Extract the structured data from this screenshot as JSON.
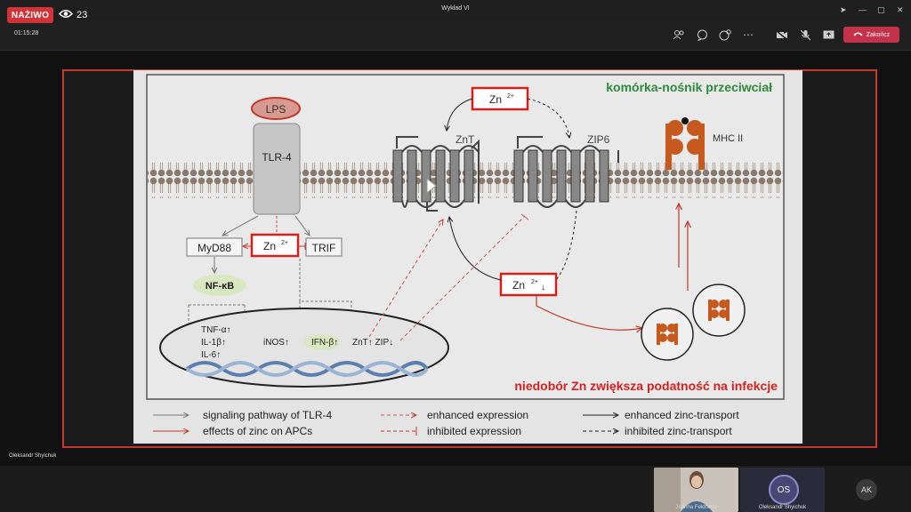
{
  "window": {
    "title": "Wykład VI"
  },
  "live": {
    "badge": "NAŻIWO",
    "viewers": "23"
  },
  "toolbar": {
    "timer": "01:15:28",
    "end_label": "Zakończ"
  },
  "presenter": {
    "name": "Oleksandr Shyichuk"
  },
  "participants": [
    {
      "name": "Joanna Feldheim",
      "initials": ""
    },
    {
      "name": "Oleksandr Shyichuk",
      "initials": "OS"
    },
    {
      "name": "",
      "initials": "AK"
    }
  ],
  "slide": {
    "title": "komórka-nośnik przeciwciał",
    "subtitle": "niedobór Zn zwiększa  podatność na infekcje",
    "labels": {
      "lps": "LPS",
      "tlr4": "TLR-4",
      "myd88": "MyD88",
      "zn": "Zn",
      "trif": "TRIF",
      "nfkb": "NF-κB",
      "znt": "ZnT",
      "zip6": "ZIP6",
      "mhc": "MHC II",
      "tnf": "TNF-α↑",
      "il1": "IL-1β↑",
      "il6": "IL-6↑",
      "inos": "iNOS↑",
      "ifn": "IFN-β↑",
      "znt_zip": "ZnT↑ ZIP↓"
    },
    "legend": [
      {
        "text": "signaling pathway of TLR-4",
        "color": "#777777",
        "style": "solid"
      },
      {
        "text": "effects of zinc on APCs",
        "color": "#c0392b",
        "style": "solid"
      },
      {
        "text": "enhanced expression",
        "color": "#d05050",
        "style": "dashed"
      },
      {
        "text": "inhibited expression",
        "color": "#c0392b",
        "style": "dashed-bar"
      },
      {
        "text": "enhanced zinc-transport",
        "color": "#222222",
        "style": "solid"
      },
      {
        "text": "inhibited zinc-transport",
        "color": "#222222",
        "style": "dashed"
      }
    ]
  }
}
